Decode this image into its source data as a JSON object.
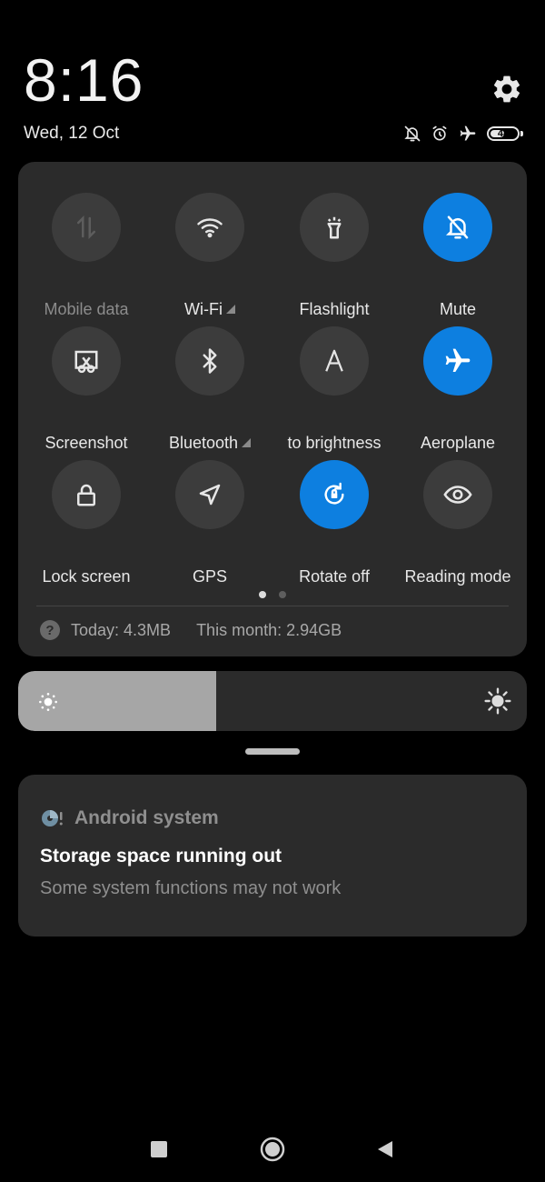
{
  "header": {
    "time": "8:16",
    "date": "Wed, 12 Oct",
    "battery_level": "48",
    "status_icons": [
      "bell-off-icon",
      "alarm-icon",
      "airplane-icon",
      "battery-icon"
    ]
  },
  "toggles": [
    {
      "label": "Mobile data",
      "icon": "mobile-data-icon",
      "active": false,
      "disabled": true
    },
    {
      "label": "Wi-Fi",
      "icon": "wifi-icon",
      "active": false,
      "has_dropdown": true
    },
    {
      "label": "Flashlight",
      "icon": "flashlight-icon",
      "active": false
    },
    {
      "label": "Mute",
      "icon": "bell-off-icon",
      "active": true
    },
    {
      "label": "Screenshot",
      "icon": "screenshot-icon",
      "active": false
    },
    {
      "label": "Bluetooth",
      "icon": "bluetooth-icon",
      "active": false,
      "has_dropdown": true
    },
    {
      "label": "to brightness",
      "icon": "auto-brightness-icon",
      "active": false
    },
    {
      "label": "Aeroplane",
      "icon": "airplane-icon",
      "active": true
    },
    {
      "label": "Lock screen",
      "icon": "lock-icon",
      "active": false
    },
    {
      "label": "GPS",
      "icon": "location-arrow-icon",
      "active": false
    },
    {
      "label": "Rotate off",
      "icon": "rotation-lock-icon",
      "active": true
    },
    {
      "label": "Reading mode",
      "icon": "eye-icon",
      "active": false
    }
  ],
  "page_indicator": {
    "pages": 2,
    "current": 1
  },
  "data_usage": {
    "today": "Today: 4.3MB",
    "month": "This month: 2.94GB"
  },
  "brightness": {
    "level": 0.39
  },
  "notification": {
    "app_name": "Android system",
    "title": "Storage space running out",
    "body": "Some system functions may not work"
  },
  "colors": {
    "accent": "#0d7fe0",
    "background": "#000000",
    "panel": "#2b2b2b",
    "tile_inactive": "#3c3c3c"
  }
}
